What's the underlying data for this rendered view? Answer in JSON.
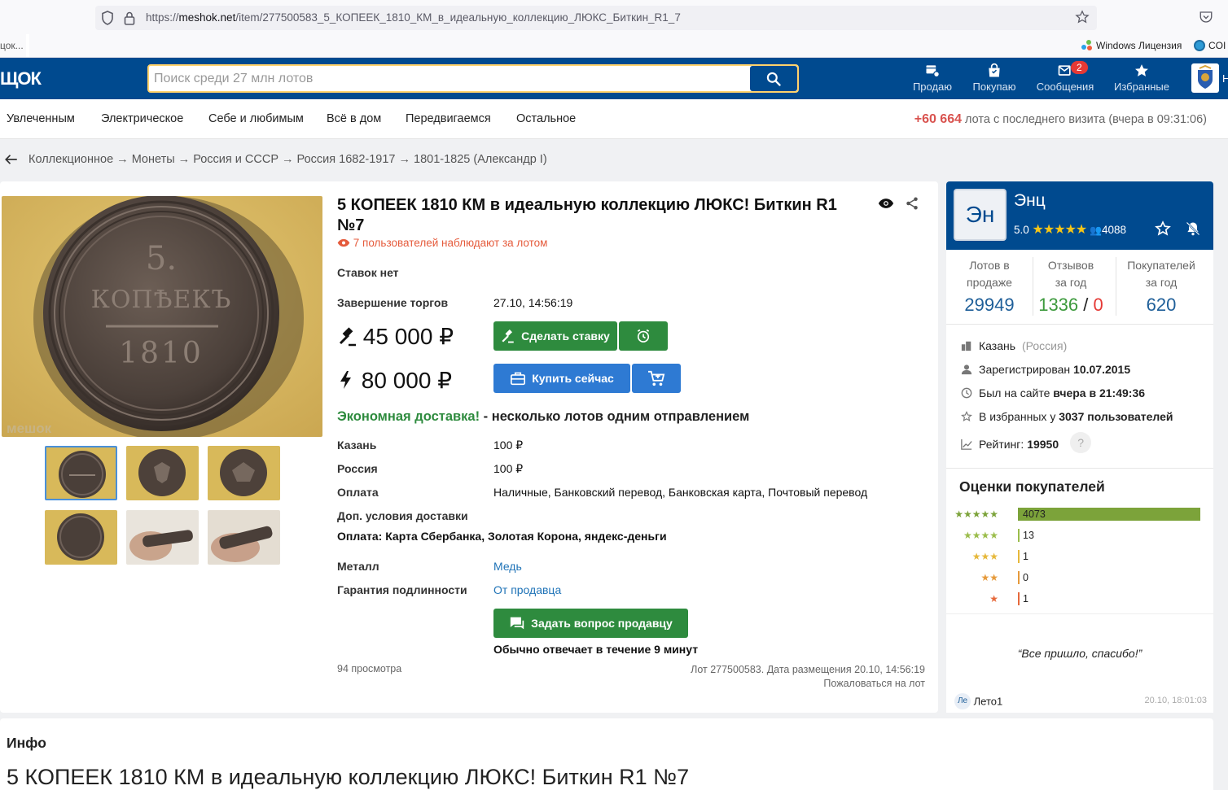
{
  "browser": {
    "url_scheme": "https://",
    "url_host": "meshok.net",
    "url_path": "/item/277500583_5_КОПЕЕК_1810_КМ_в_идеальную_коллекцию_ЛЮКС_Биткин_R1_7",
    "bookmark_left": "цок...",
    "bookmark_windows": "Windows Лицензия",
    "bookmark_coi": "COI"
  },
  "header": {
    "logo": "ЩОК",
    "search_placeholder": "Поиск среди 27 млн лотов",
    "nav": [
      "Продаю",
      "Покупаю",
      "Сообщения",
      "Избранные"
    ],
    "messages_badge": "2",
    "avatar_letter": "Н"
  },
  "categories": [
    "Увлеченным",
    "Электрическое",
    "Себе и любимым",
    "Всё в дом",
    "Передвигаемся",
    "Остальное"
  ],
  "visits": {
    "count": "+60 664",
    "text": "лота с последнего визита (вчера в 09:31:06)"
  },
  "breadcrumb": "Коллекционное → Монеты → Россия и СССР → Россия 1682-1917 → 1801-1825 (Александр I)",
  "coin": {
    "denomination": "5.",
    "word": "КОПѢЕКЪ",
    "year": "1810",
    "watermark": "мешок"
  },
  "lot": {
    "title": "5 КОПЕЕК 1810 КМ в идеальную коллекцию ЛЮКС! Биткин R1 №7",
    "watchers": "7 пользователей наблюдают за лотом",
    "bids": "Ставок нет",
    "end_label": "Завершение торгов",
    "end_value": "27.10, 14:56:19",
    "bid_price": "45 000 ₽",
    "bid_button": "Сделать ставку",
    "buy_price": "80 000 ₽",
    "buy_button": "Купить сейчас",
    "eco_green": "Экономная доставка!",
    "eco_rest": " - несколько лотов одним отправлением",
    "delivery": [
      {
        "label": "Казань",
        "value": "100 ₽"
      },
      {
        "label": "Россия",
        "value": "100 ₽"
      },
      {
        "label": "Оплата",
        "value": "Наличные, Банковский перевод, Банковская карта, Почтовый перевод"
      }
    ],
    "extra_label": "Доп. условия доставки",
    "extra_value": "Оплата: Карта Сбербанка, Золотая Корона, яндекс-деньги",
    "metal_label": "Металл",
    "metal_value": "Медь",
    "guarantee_label": "Гарантия подлинности",
    "guarantee_value": "От продавца",
    "ask_button": "Задать вопрос продавцу",
    "response": "Обычно отвечает в течение 9 минут",
    "views": "94 просмотра",
    "lot_meta": "Лот 277500583. Дата размещения 20.10, 14:56:19",
    "report": "Пожаловаться на лот"
  },
  "seller": {
    "initials": "Эн",
    "name": "Энц",
    "rating": "5.0",
    "reviews_count": "4088",
    "stat_labels": [
      "Лотов в продаже",
      "Отзывов за год",
      "Покупателей за год"
    ],
    "lots": "29949",
    "reviews_pos": "1336",
    "reviews_sep": "/",
    "reviews_neg": "0",
    "buyers": "620",
    "city": "Казань",
    "country": "(Россия)",
    "registered_label": "Зарегистрирован",
    "registered": "10.07.2015",
    "seen_label": "Был на сайте",
    "seen": "вчера в 21:49:36",
    "fav_label": "В избранных у",
    "fav": "3037 пользователей",
    "rating_label": "Рейтинг:",
    "rating_value": "19950",
    "help": "?"
  },
  "ratings": {
    "title": "Оценки покупателей",
    "rows": [
      {
        "stars": "★★★★★",
        "count": "4073",
        "color": "#7ca33a",
        "fraction": 1.0
      },
      {
        "stars": "★★★★",
        "count": "13",
        "color": "#9bbd4b",
        "fraction": 0.0
      },
      {
        "stars": "★★★",
        "count": "1",
        "color": "#e6b83b",
        "fraction": 0.0
      },
      {
        "stars": "★★",
        "count": "0",
        "color": "#e69a3b",
        "fraction": 0.0
      },
      {
        "stars": "★",
        "count": "1",
        "color": "#e6693b",
        "fraction": 0.0
      }
    ]
  },
  "review": {
    "text": "“Все пришло, спасибо!”",
    "author_initials": "Ле",
    "author": "Лето1",
    "date": "20.10, 18:01:03"
  },
  "info": {
    "heading": "Инфо",
    "title": "5 КОПЕЕК 1810 КМ в идеальную коллекцию ЛЮКС! Биткин R1 №7"
  },
  "colors": {
    "brand": "#004a8f",
    "green": "#2e8b3e",
    "blue": "#2e7ad3",
    "alert": "#e55b3c"
  }
}
